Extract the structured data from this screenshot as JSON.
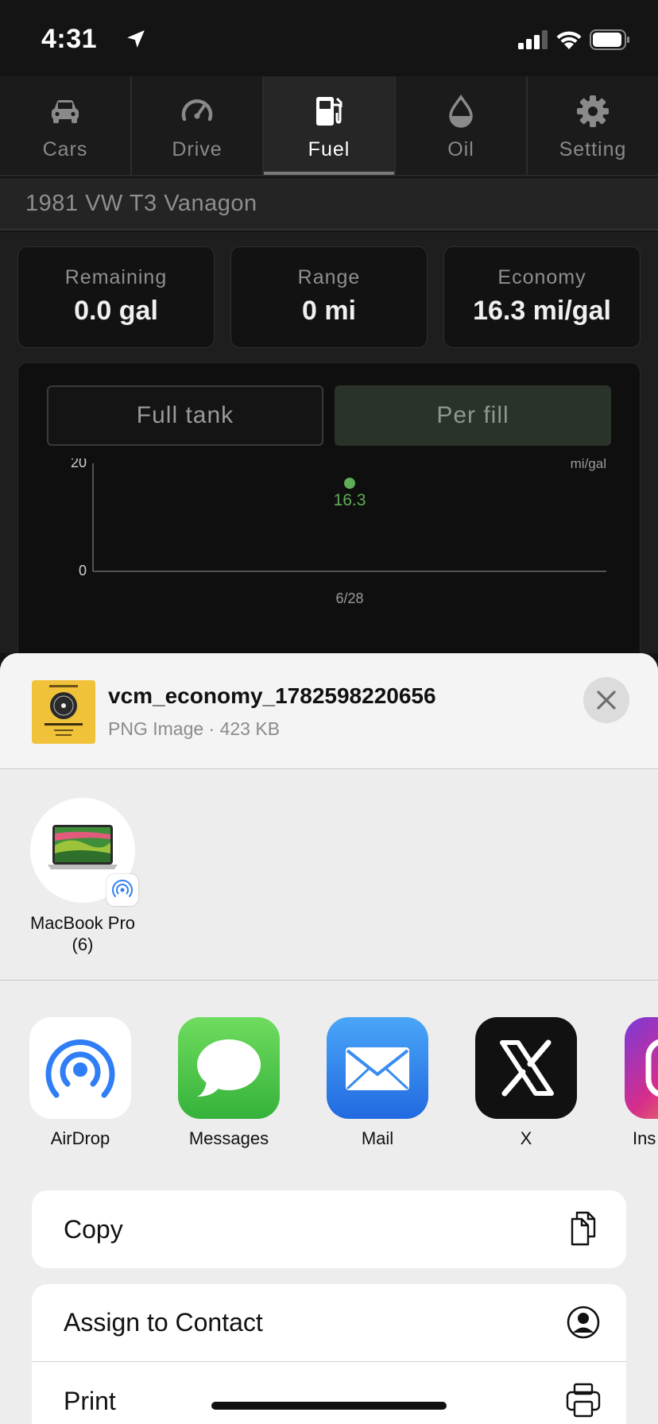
{
  "status_bar": {
    "time": "4:31"
  },
  "tabs": [
    {
      "label": "Cars",
      "icon": "car-icon",
      "active": false
    },
    {
      "label": "Drive",
      "icon": "speedometer-icon",
      "active": false
    },
    {
      "label": "Fuel",
      "icon": "fuel-pump-icon",
      "active": true
    },
    {
      "label": "Oil",
      "icon": "oil-drop-icon",
      "active": false
    },
    {
      "label": "Setting",
      "icon": "gear-icon",
      "active": false
    }
  ],
  "car": {
    "title": "1981 VW T3 Vanagon"
  },
  "stats": [
    {
      "label": "Remaining",
      "value": "0.0 gal"
    },
    {
      "label": "Range",
      "value": "0 mi"
    },
    {
      "label": "Economy",
      "value": "16.3 mi/gal"
    }
  ],
  "chart_toggle": {
    "full_tank": "Full tank",
    "per_fill": "Per fill",
    "selected": "per_fill"
  },
  "chart_data": {
    "type": "scatter",
    "categories": [
      "6/28"
    ],
    "values": [
      16.3
    ],
    "data_labels": [
      "16.3"
    ],
    "ylabel": "mi/gal",
    "ylim": [
      0,
      20
    ],
    "y_ticks": [
      "0",
      "20"
    ],
    "point_color": "#5fae57",
    "grid": false
  },
  "share_sheet": {
    "file_name": "vcm_economy_1782598220656",
    "file_meta": "PNG Image · 423 KB",
    "device": {
      "name_line1": "MacBook Pro",
      "name_line2": "(6)"
    },
    "apps": [
      {
        "label": "AirDrop",
        "icon": "airdrop-icon"
      },
      {
        "label": "Messages",
        "icon": "messages-icon"
      },
      {
        "label": "Mail",
        "icon": "mail-icon"
      },
      {
        "label": "X",
        "icon": "x-logo-icon"
      },
      {
        "label": "Ins",
        "icon": "instagram-icon"
      }
    ],
    "actions": {
      "copy": "Copy",
      "assign": "Assign to Contact",
      "print": "Print"
    }
  }
}
